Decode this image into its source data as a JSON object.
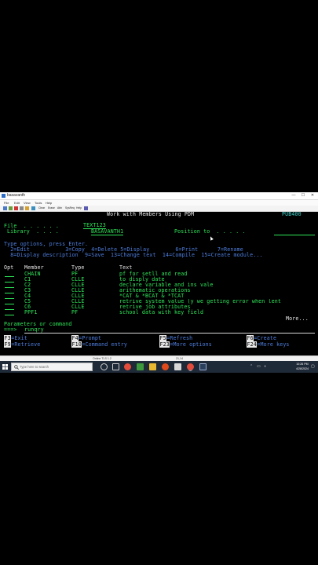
{
  "window": {
    "title": "basavanth",
    "buttons": [
      "—",
      "☐",
      "✕"
    ]
  },
  "menubar": [
    "File",
    "Edit",
    "View",
    "Tools",
    "Help"
  ],
  "toolbar": [
    "Clear",
    "Erase",
    "Attn",
    "SysReq",
    "Help"
  ],
  "screen": {
    "header_title": "Work with Members Using PDM",
    "system_name": "PUB400",
    "file_label": "File  . . . . . .",
    "file_value": "TEXT123",
    "library_label": "Library  . . . .",
    "library_value": "BASAVANTH1",
    "position_label": "Position to  . . . . .",
    "options_heading": "Type options, press Enter.",
    "options_line1": "  2=Edit           3=Copy  4=Delete 5=Display        6=Print      7=Rename",
    "options_line2": "  8=Display description  9=Save  13=Change text  14=Compile  15=Create module...",
    "col_opt": "Opt",
    "col_member": "Member",
    "col_type": "Type",
    "col_text": "Text",
    "rows": [
      {
        "member": "CHAIN",
        "type": "PF",
        "text": "pf for setll and read"
      },
      {
        "member": "C1",
        "type": "CLLE",
        "text": "to disply date"
      },
      {
        "member": "C2",
        "type": "CLLE",
        "text": "declare variable and ins vale"
      },
      {
        "member": "C3",
        "type": "CLLE",
        "text": "arithematic operations"
      },
      {
        "member": "C4",
        "type": "CLLE",
        "text": "*CAT & *BCAT & *TCAT"
      },
      {
        "member": "C5",
        "type": "CLLE",
        "text": "retrive system value (y we getting error when lent"
      },
      {
        "member": "C6",
        "type": "CLLE",
        "text": "retrive job attributes"
      },
      {
        "member": "PPF1",
        "type": "PF",
        "text": "school data with key field"
      }
    ],
    "more": "More...",
    "params_label": "Parameters or command",
    "prompt": "===>",
    "command_value": "runqry",
    "fkeys": [
      {
        "key": "F3",
        "label": "=Exit"
      },
      {
        "key": "F4",
        "label": "=Prompt"
      },
      {
        "key": "F5",
        "label": "=Refresh"
      },
      {
        "key": "F6",
        "label": "=Create"
      },
      {
        "key": "F9",
        "label": "=Retrieve"
      },
      {
        "key": "F10",
        "label": "=Command entry"
      },
      {
        "key": "F23",
        "label": "=More options"
      },
      {
        "key": "F24",
        "label": "=More keys"
      }
    ]
  },
  "statusbar": {
    "status": "Online TLS 1.2",
    "cursor_pos": "21,14"
  },
  "taskbar": {
    "search_placeholder": "Type here to search",
    "time": "10:26 PM",
    "date": "4/28/2024"
  },
  "colors": {
    "terminal_bg": "#000000",
    "green": "#2ee85a",
    "blue": "#4f7fe0",
    "turquoise": "#3fd0c7",
    "white": "#e8e8e8",
    "taskbar": "#1f2a38"
  }
}
